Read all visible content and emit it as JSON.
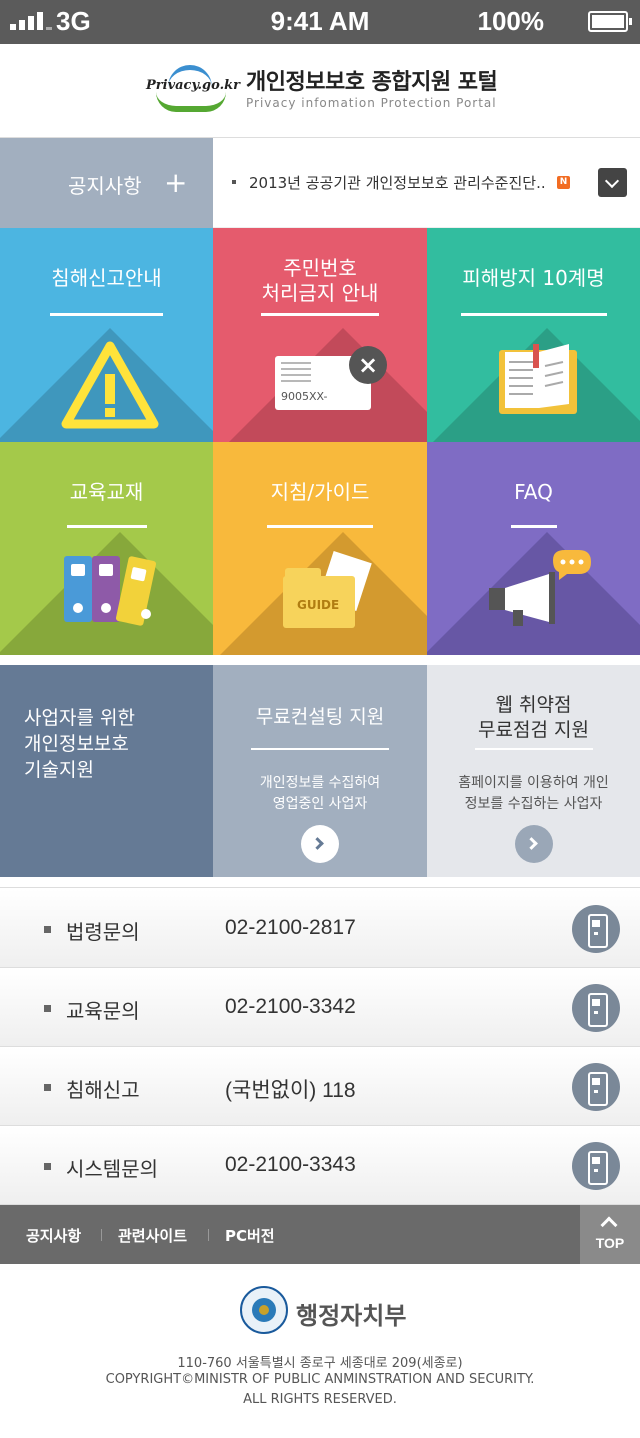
{
  "status_bar": {
    "network": "3G",
    "time": "9:41 AM",
    "battery": "100%"
  },
  "header": {
    "logo_text": "Privacy.go.kr",
    "title": "개인정보보호 종합지원 포털",
    "subtitle": "Privacy infomation Protection Portal"
  },
  "notice": {
    "label": "공지사항",
    "plus": "+",
    "headline": "2013년 공공기관 개인정보보호 관리수준진단..",
    "new_badge": "N"
  },
  "menu_tiles": [
    {
      "title": "침해신고안내",
      "color": "#4cb5e1",
      "icon": "warning-icon"
    },
    {
      "title": "주민번호\n처리금지 안내",
      "card_text": "9005XX-",
      "color": "#e55b6d",
      "icon": "id-card-icon"
    },
    {
      "title": "피해방지 10계명",
      "color": "#32bd9f",
      "icon": "book-icon"
    },
    {
      "title": "교육교재",
      "color": "#a4c94a",
      "icon": "binders-icon"
    },
    {
      "title": "지침/가이드",
      "folder_text": "GUIDE",
      "color": "#f8b93c",
      "icon": "folder-icon"
    },
    {
      "title": "FAQ",
      "color": "#7f6cc4",
      "icon": "megaphone-icon"
    }
  ],
  "support": {
    "tech": {
      "title": "사업자를 위한\n개인정보보호\n기술지원"
    },
    "consulting": {
      "title": "무료컨설팅 지원",
      "desc": "개인정보를 수집하여\n영업중인 사업자"
    },
    "web": {
      "title": "웹 취약점\n무료점검 지원",
      "desc": "홈페이지를 이용하여 개인\n정보를 수집하는 사업자"
    }
  },
  "contacts": [
    {
      "label": "법령문의",
      "number": "02-2100-2817"
    },
    {
      "label": "교육문의",
      "number": "02-2100-3342"
    },
    {
      "label": "침해신고",
      "number": "(국번없이) 118"
    },
    {
      "label": "시스템문의",
      "number": "02-2100-3343"
    }
  ],
  "footer_nav": {
    "notice": "공지사항",
    "related": "관련사이트",
    "pc": "PC버전",
    "top": "TOP"
  },
  "footer": {
    "ministry": "행정자치부",
    "address": "110-760 서울특별시 종로구 세종대로 209(세종로)",
    "copyright": "COPYRIGHT©MINISTR OF PUBLIC ANMINSTRATION AND SECURITY.",
    "rights": "ALL RIGHTS RESERVED."
  }
}
